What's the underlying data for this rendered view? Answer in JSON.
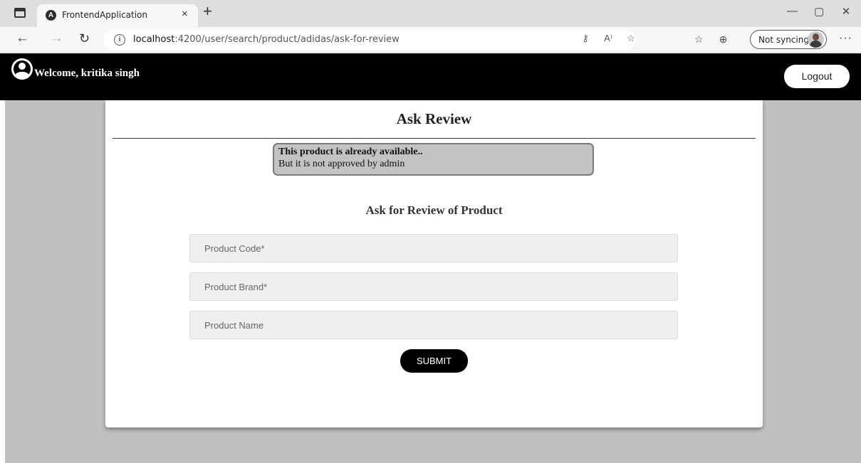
{
  "browser": {
    "tab_title": "FrontendApplication",
    "tab_close": "×",
    "new_tab": "+",
    "url_host": "localhost",
    "url_path": ":4200/user/search/product/adidas/ask-for-review",
    "sync_label": "Not syncing",
    "more": "···",
    "window_controls": [
      "—",
      "▢",
      "✕"
    ],
    "icons": [
      "sidebar-icon",
      "angular-favicon-icon",
      "back-arrow-icon",
      "forward-arrow-icon",
      "refresh-icon",
      "info-icon",
      "key-icon",
      "read-aloud-icon",
      "favorite-add-icon",
      "favorites-icon",
      "collections-icon",
      "profile-avatar-icon",
      "more-icon"
    ]
  },
  "header": {
    "welcome": "Welcome, kritika singh",
    "logout_label": "Logout"
  },
  "card": {
    "title": "Ask Review",
    "alert_title": "This product is already available..",
    "alert_message": "But it is not approved by admin",
    "form_heading": "Ask for Review of Product",
    "fields": {
      "product_code_placeholder": "Product Code*",
      "product_brand_placeholder": "Product Brand*",
      "product_name_placeholder": "Product Name"
    },
    "submit_label": "SUBMIT"
  },
  "colors": {
    "header_bg": "#000000",
    "page_bg": "#c0c0c0",
    "alert_bg": "#c3c3c3",
    "button_bg": "#000000"
  }
}
